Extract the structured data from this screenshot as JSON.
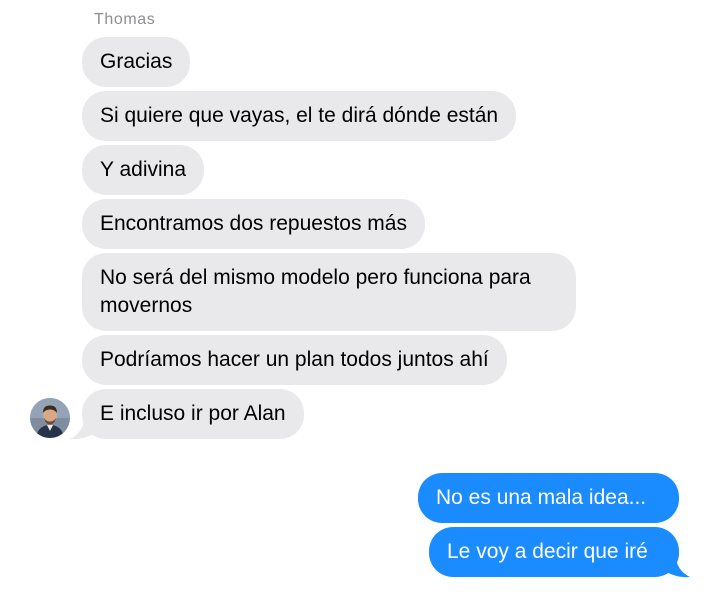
{
  "conversation": {
    "sender_name": "Thomas",
    "incoming": [
      "Gracias",
      "Si quiere que vayas, el te dirá dónde están",
      "Y adivina",
      "Encontramos dos repuestos más",
      "No será del mismo modelo pero funciona para movernos",
      "Podríamos hacer un plan todos juntos ahí",
      "E incluso ir por Alan"
    ],
    "outgoing": [
      "No es una mala idea...",
      "Le voy a decir que iré"
    ]
  },
  "colors": {
    "incoming_bubble": "#e9e9eb",
    "outgoing_bubble": "#1a8cff",
    "sender_name": "#8e8e93"
  },
  "icons": {
    "avatar": "person-avatar"
  }
}
